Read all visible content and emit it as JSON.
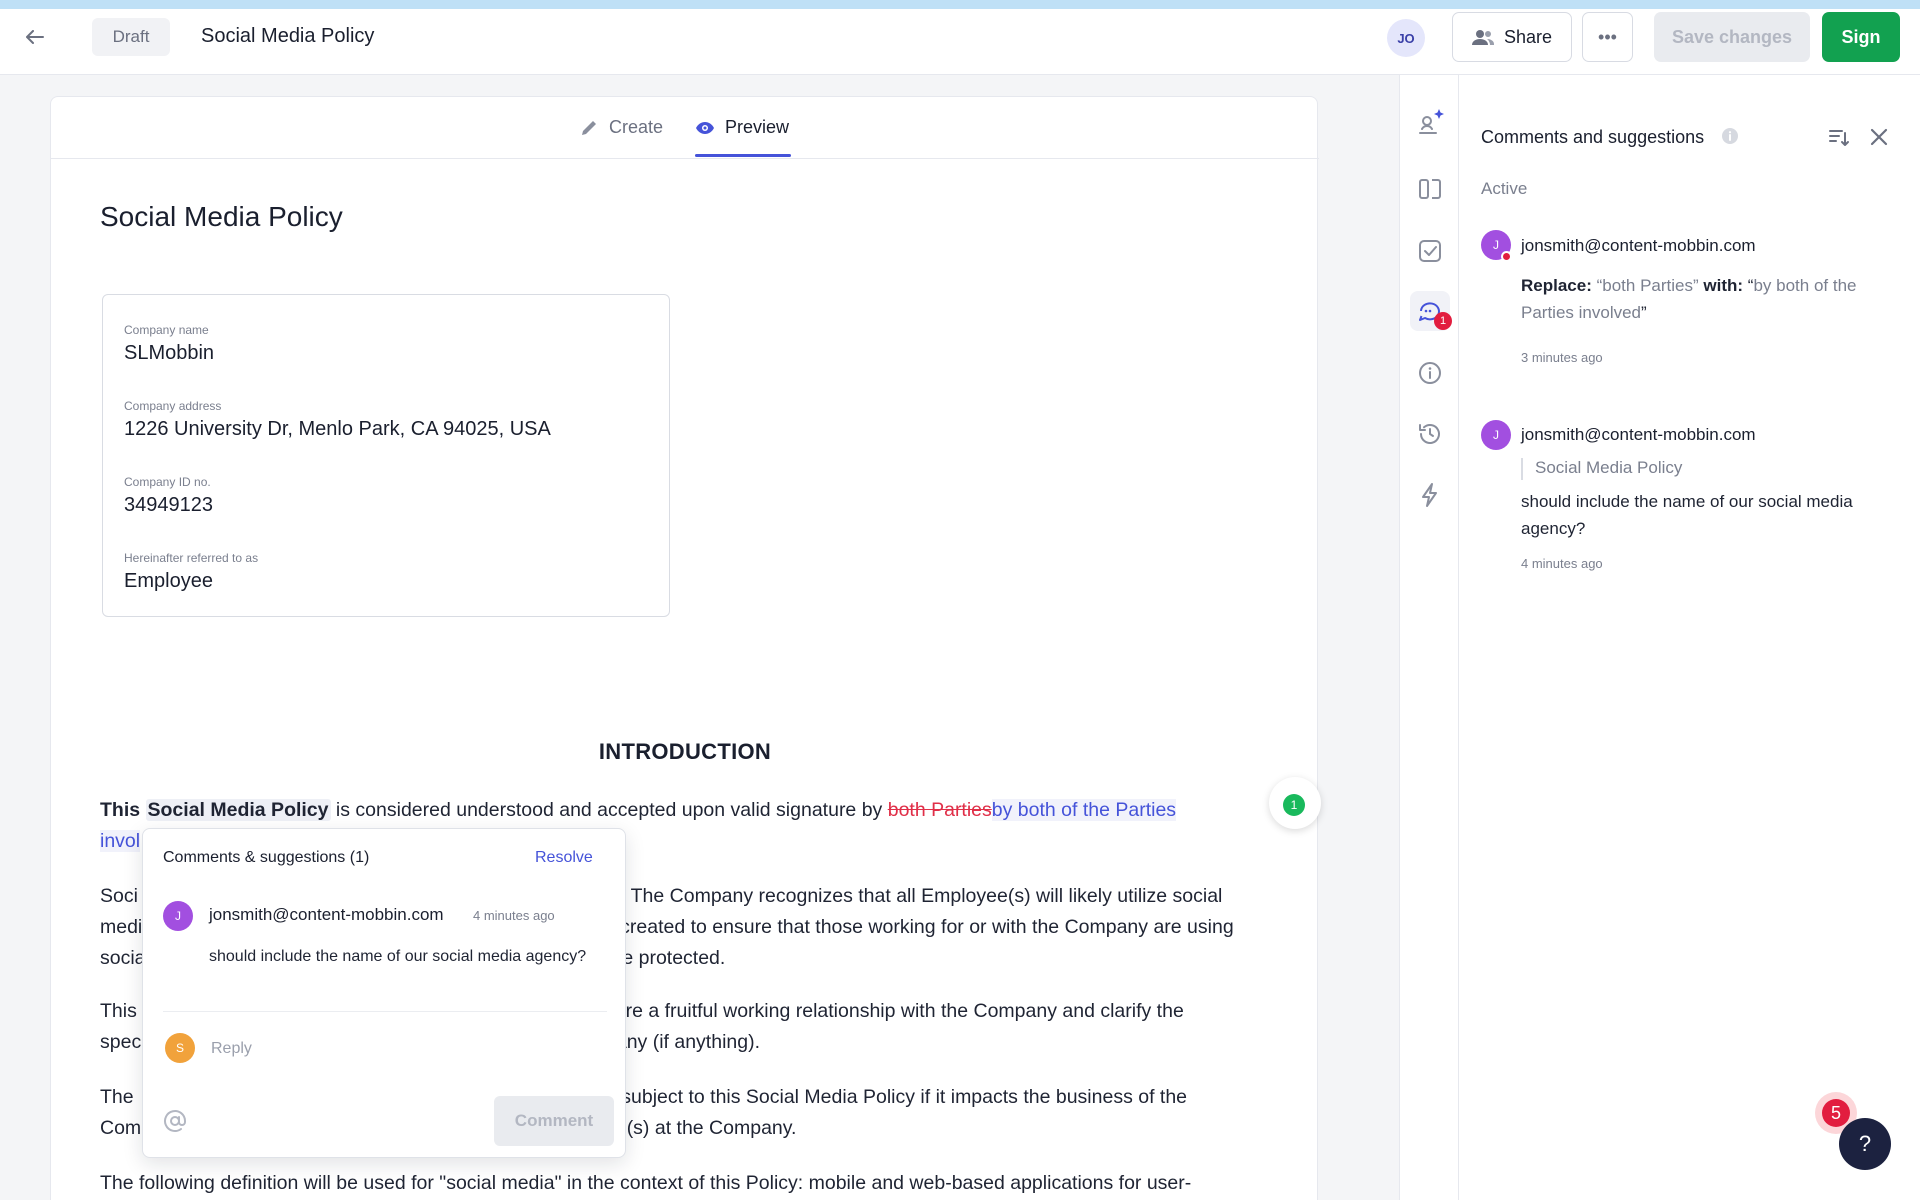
{
  "header": {
    "status_pill": "Draft",
    "title": "Social Media Policy",
    "user_initials": "JO",
    "share_label": "Share",
    "more_label": "•••",
    "save_label": "Save changes",
    "sign_label": "Sign"
  },
  "tabs": [
    {
      "label": "Create",
      "active": false
    },
    {
      "label": "Preview",
      "active": true
    }
  ],
  "document": {
    "heading": "Social Media Policy",
    "fields": [
      {
        "label": "Company name",
        "value": "SLMobbin"
      },
      {
        "label": "Company address",
        "value": "1226 University Dr, Menlo Park, CA 94025, USA"
      },
      {
        "label": "Company ID no.",
        "value": "34949123"
      },
      {
        "label": "Hereinafter referred to as",
        "value": "Employee"
      }
    ],
    "section_title": "INTRODUCTION",
    "p1": {
      "bold_this": "This",
      "bold_highlight": "Social Media Policy",
      "text": " is considered understood and accepted upon valid signature by ",
      "deleted": "both Parties",
      "inserted": "by both of the Parties",
      "line2": "invol"
    },
    "p2": {
      "line1_start": "Soci",
      "line1_end": "ct. The Company recognizes that all Employee(s) will likely utilize social",
      "line2_start": "medi",
      "line2_end": "s created to ensure that those working for or with the Company are using",
      "line3_start": "socia",
      "line3_end": "are protected."
    },
    "p3": {
      "line1_start": "This",
      "line1_end": "sure a fruitful working relationship with the Company and clarify the",
      "line2_start": "spec",
      "line2_end": "pany (if anything)."
    },
    "p4": {
      "line1_start": "The",
      "line1_end": "e subject to this Social Media Policy if it impacts the business of the",
      "line2_start": "Com",
      "line2_end": "ee(s) at the Company."
    },
    "p5": "The following definition will be used for \"social media\" in the context of this Policy: mobile and web-based applications for user-",
    "marker_count": "1"
  },
  "popover": {
    "title": "Comments & suggestions (1)",
    "resolve_label": "Resolve",
    "author_initial": "J",
    "author": "jonsmith@content-mobbin.com",
    "time": "4 minutes ago",
    "text": "should include the name of our social media agency?",
    "reply_initial": "S",
    "reply_placeholder": "Reply",
    "comment_label": "Comment"
  },
  "rail": {
    "badge_count": "1"
  },
  "sidebar": {
    "title": "Comments and suggestions",
    "filter": "Active",
    "comments": [
      {
        "initial": "J",
        "author": "jonsmith@content-mobbin.com",
        "replace_label": "Replace:",
        "replace_from": "“both Parties”",
        "with_label": "with:",
        "replace_to_open": "“",
        "replace_to": "by both of the Parties involved",
        "replace_to_close": "”",
        "time": "3 minutes ago"
      },
      {
        "initial": "J",
        "author": "jonsmith@content-mobbin.com",
        "quote": "Social Media Policy",
        "text": "should include the name of our social media agency?",
        "time": "4 minutes ago"
      }
    ]
  },
  "notifications_count": "5",
  "help_label": "?",
  "colors": {
    "accent": "#4553d9",
    "sign_green": "#12a150",
    "badge_red": "#e21d3f",
    "avatar_purple": "#a24fe0",
    "avatar_orange": "#f1a23b"
  }
}
